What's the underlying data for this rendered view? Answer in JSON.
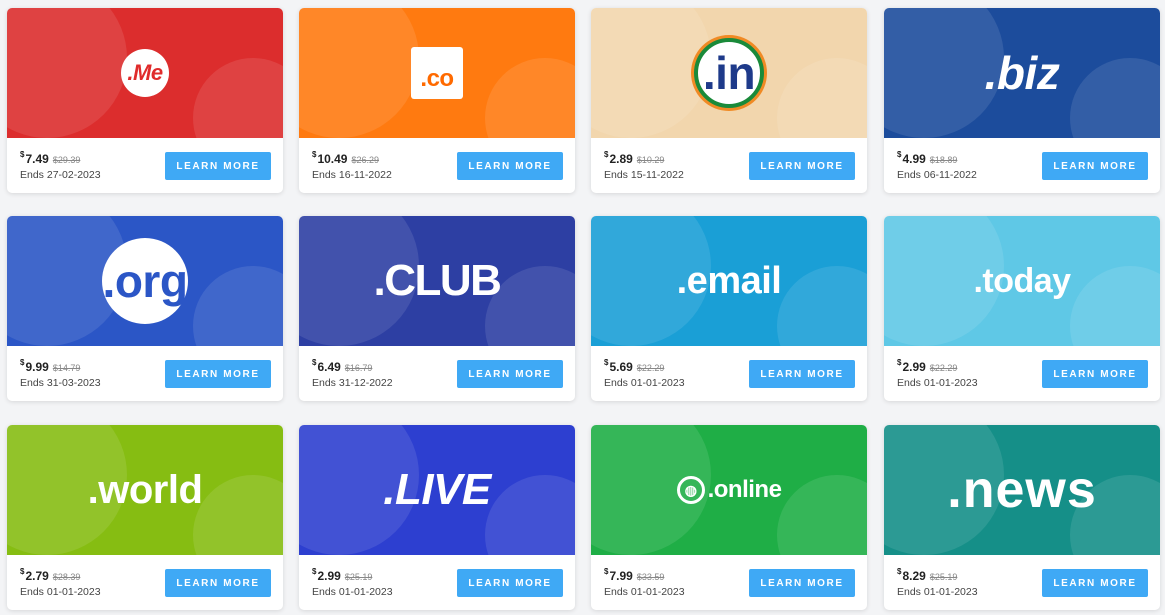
{
  "cards": [
    {
      "tld": ".Me",
      "logo_style": "me",
      "bg": "#dc2d2d",
      "currency": "$",
      "price": "7.49",
      "old_price": "$29.39",
      "ends": "Ends 27-02-2023",
      "button": "LEARN MORE"
    },
    {
      "tld": ".co",
      "logo_style": "co",
      "bg": "#ff7a10",
      "currency": "$",
      "price": "10.49",
      "old_price": "$26.29",
      "ends": "Ends 16-11-2022",
      "button": "LEARN MORE"
    },
    {
      "tld": ".in",
      "logo_style": "in",
      "bg": "#f2d6ad",
      "currency": "$",
      "price": "2.89",
      "old_price": "$10.29",
      "ends": "Ends 15-11-2022",
      "button": "LEARN MORE"
    },
    {
      "tld": ".biz",
      "logo_style": "biz",
      "bg": "#1c4c9c",
      "currency": "$",
      "price": "4.99",
      "old_price": "$18.89",
      "ends": "Ends 06-11-2022",
      "button": "LEARN MORE"
    },
    {
      "tld": ".org",
      "logo_style": "org",
      "bg": "#2b56c6",
      "currency": "$",
      "price": "9.99",
      "old_price": "$14.79",
      "ends": "Ends 31-03-2023",
      "button": "LEARN MORE"
    },
    {
      "tld": ".CLUB",
      "logo_style": "club",
      "bg": "#2d3fa3",
      "currency": "$",
      "price": "6.49",
      "old_price": "$16.79",
      "ends": "Ends 31-12-2022",
      "button": "LEARN MORE"
    },
    {
      "tld": ".email",
      "logo_style": "email",
      "bg": "#1a9fd6",
      "currency": "$",
      "price": "5.69",
      "old_price": "$22.29",
      "ends": "Ends 01-01-2023",
      "button": "LEARN MORE"
    },
    {
      "tld": ".today",
      "logo_style": "today",
      "bg": "#5fc8e6",
      "currency": "$",
      "price": "2.99",
      "old_price": "$22.29",
      "ends": "Ends 01-01-2023",
      "button": "LEARN MORE"
    },
    {
      "tld": ".world",
      "logo_style": "world",
      "bg": "#86bd12",
      "currency": "$",
      "price": "2.79",
      "old_price": "$28.39",
      "ends": "Ends 01-01-2023",
      "button": "LEARN MORE"
    },
    {
      "tld": ".LIVE",
      "logo_style": "live",
      "bg": "#2d3fd0",
      "currency": "$",
      "price": "2.99",
      "old_price": "$25.19",
      "ends": "Ends 01-01-2023",
      "button": "LEARN MORE"
    },
    {
      "tld": ".online",
      "logo_style": "online",
      "bg": "#1fae46",
      "currency": "$",
      "price": "7.99",
      "old_price": "$33.59",
      "ends": "Ends 01-01-2023",
      "button": "LEARN MORE"
    },
    {
      "tld": ".news",
      "logo_style": "news",
      "bg": "#158f88",
      "currency": "$",
      "price": "8.29",
      "old_price": "$25.19",
      "ends": "Ends 01-01-2023",
      "button": "LEARN MORE"
    }
  ]
}
